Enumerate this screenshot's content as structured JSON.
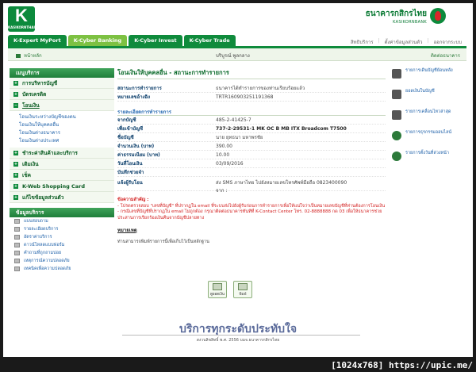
{
  "header": {
    "logo_text": "K",
    "logo_sub": "KASIKORNTHAI",
    "bank_name_th": "ธนาคารกสิกรไทย",
    "bank_name_en": "KASIKORNBANK"
  },
  "tabs": [
    "K-Expert MyPort",
    "K-Cyber Banking",
    "K-Cyber Invest",
    "K-Cyber Trade"
  ],
  "top_links": [
    "สิทธิบริการ",
    "ตั้งค่าข้อมูลส่วนตัว",
    "ออกจากระบบ"
  ],
  "crumb": {
    "home": "หน้าหลัก",
    "user": "บริบูรณ์ พูลกลาง",
    "settings": "ติดต่อธนาคาร"
  },
  "sidebar": {
    "menu_title": "เมนูบริการ",
    "items": [
      "การบริหารบัญชี",
      "บัตรเครดิต",
      "โอนเงิน"
    ],
    "transfer_subitems": [
      "โอนเงินระหว่างบัญชีของตน",
      "โอนเงินให้บุคคลอื่น",
      "โอนเงินต่างธนาคาร",
      "โอนเงินต่างประเทศ"
    ],
    "items2": [
      "ชำระค่าสินค้าและบริการ",
      "เติมเงิน",
      "เช็ค",
      "K-Web Shopping Card",
      "แก้ไขข้อมูลส่วนตัว"
    ],
    "services_title": "ข้อมูลบริการ",
    "services": [
      "แบบสอบถาม",
      "รายละเอียดบริการ",
      "อัตราค่าบริการ",
      "ดาวน์โหลดแบบฟอร์ม",
      "คำถามที่ถูกถามบ่อย",
      "เหตุการณ์ความปลอดภัย",
      "เทคนิคเพื่อความปลอดภัย"
    ]
  },
  "main": {
    "title": "โอนเงินให้บุคคลอื่น - สถานะการทำรายการ",
    "status_label": "สถานะการทำรายการ",
    "status_value": "ธนาคารได้ทำรายการของท่านเรียบร้อยแล้ว",
    "ref_label": "หมายเลขอ้างอิง",
    "ref_value": "TRTR160903251191368",
    "detail_head": "รายละเอียดการทำรายการ",
    "from_label": "จากบัญชี",
    "from_value": "485-2-41425-7",
    "to_label": "เพื่อเข้าบัญชี",
    "to_value": "737-2-29531-1 MK OC B MB ITX Broadcom T7500",
    "name_label": "ชื่อบัญชี",
    "name_value": "นาย ยุทธนา มหาพรชัย",
    "amount_label": "จำนวนเงิน (บาท)",
    "amount_value": "390.00",
    "fee_label": "ค่าธรรมเนียม (บาท)",
    "fee_value": "10.00",
    "date_label": "วันที่โอนเงิน",
    "date_value": "03/09/2016",
    "memo_label": "บันทึกช่วยจำ",
    "memo_value": "",
    "notify_label": "แจ้งผู้รับโอน",
    "notify_value": "ส่ง SMS ภาษาไทย ไปยังหมายเลขโทรศัพท์มือถือ 0823400090",
    "notify_value2": "จาก :",
    "notes_head": "ข้อความสำคัญ :",
    "note1": "- โปรดตรวจสอบ \"เลขที่บัญชี\" ที่ปรากฏใน email ที่ระบบส่งไปยังผู้รับก่อนการทำรายการเพื่อให้แน่ใจว่าเป็นหมายเลขบัญชีที่ท่านต้องการโอนเงิน",
    "note2": "- กรณีเลขที่บัญชีที่ปรากฏใน email ไม่ถูกต้อง กรุณาติดต่อธนาคารทันทีที่ K-Contact Center โทร. 02-8888888 กด 03 เพื่อให้ธนาคารช่วยประสานการเรียกร้องเงินคืนจากบัญชีปลายทาง",
    "remark_head": "หมายเหตุ",
    "remark_text": "ท่านสามารถพิมพ์รายการนี้เพื่อเก็บไว้เป็นหลักฐาน",
    "btn_view": "ดูยอดเงิน",
    "btn_print": "พิมพ์"
  },
  "right_panel": [
    "รายการเดินบัญชีย้อนหลัง",
    "ยอดเงินในบัญชี",
    "รายการเคลื่อนไหวล่าสุด",
    "รายการธุรกรรมออนไลน์",
    "รายการตั้งวันที่ล่วงหน้า"
  ],
  "footer": {
    "title": "บริการทุกระดับประทับใจ",
    "copy": "สงวนลิขสิทธิ์ พ.ศ. 2556 บมจ.ธนาคารกสิกรไทย"
  },
  "watermark": "[1024x768] https://upic.me/"
}
